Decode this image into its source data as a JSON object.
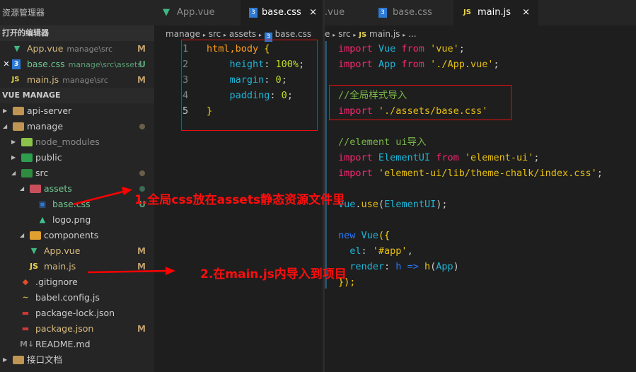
{
  "sidebar": {
    "title": "资源管理器",
    "open_editors_header": "打开的编辑器",
    "open_editors": [
      {
        "name": "App.vue",
        "path": "manage\\src",
        "status": "M",
        "icon": "vue-icon"
      },
      {
        "name": "base.css",
        "path": "manage\\src\\assets",
        "status": "U",
        "icon": "css-icon"
      },
      {
        "name": "main.js",
        "path": "manage\\src",
        "status": "M",
        "icon": "js-icon"
      }
    ],
    "project_header": "VUE MANAGE",
    "tree": [
      {
        "name": "api-server",
        "status": ""
      },
      {
        "name": "manage",
        "status": ""
      },
      {
        "name": "node_modules",
        "status": ""
      },
      {
        "name": "public",
        "status": ""
      },
      {
        "name": "src",
        "status": ""
      },
      {
        "name": "assets",
        "status": ""
      },
      {
        "name": "base.css",
        "status": "U"
      },
      {
        "name": "logo.png",
        "status": ""
      },
      {
        "name": "components",
        "status": ""
      },
      {
        "name": "App.vue",
        "status": "M"
      },
      {
        "name": "main.js",
        "status": "M"
      },
      {
        "name": ".gitignore",
        "status": ""
      },
      {
        "name": "babel.config.js",
        "status": ""
      },
      {
        "name": "package-lock.json",
        "status": ""
      },
      {
        "name": "package.json",
        "status": "M"
      },
      {
        "name": "README.md",
        "status": ""
      },
      {
        "name": "接口文档",
        "status": ""
      }
    ]
  },
  "left_editor": {
    "tabs": [
      {
        "label": "App.vue"
      },
      {
        "label": "base.css",
        "close": "×"
      }
    ],
    "breadcrumb": [
      "manage",
      "src",
      "assets",
      "base.css"
    ],
    "line_numbers": [
      "1",
      "2",
      "3",
      "4",
      "5"
    ]
  },
  "right_editor": {
    "tabs": [
      {
        "label": ".vue"
      },
      {
        "label": "base.css"
      },
      {
        "label": "main.js",
        "close": "×"
      }
    ],
    "breadcrumb": [
      "e",
      "src",
      "main.js",
      "..."
    ]
  },
  "annotations": {
    "note1": "1.全局css放在assets静态资源文件里",
    "note2": "2.在main.js内导入到项目",
    "color": "#ff0d0d"
  },
  "css_code": [
    [
      [
        "html,body ",
        "sel"
      ],
      [
        "{",
        "br"
      ]
    ],
    [
      [
        "    height",
        "pr"
      ],
      [
        ": ",
        "pun"
      ],
      [
        "100%",
        "num2"
      ],
      [
        ";",
        "pun"
      ]
    ],
    [
      [
        "    margin",
        "pr"
      ],
      [
        ": ",
        "pun"
      ],
      [
        "0",
        "num2"
      ],
      [
        ";",
        "pun"
      ]
    ],
    [
      [
        "    padding",
        "pr"
      ],
      [
        ": ",
        "pun"
      ],
      [
        "0",
        "num2"
      ],
      [
        ";",
        "pun"
      ]
    ],
    [
      [
        "}",
        "br"
      ]
    ]
  ],
  "js_code": [
    [
      [
        "import ",
        "kw"
      ],
      [
        "Vue ",
        "cls"
      ],
      [
        "from ",
        "kw"
      ],
      [
        "'vue'",
        "str"
      ],
      [
        ";",
        "pun"
      ]
    ],
    [
      [
        "import ",
        "kw"
      ],
      [
        "App ",
        "cls"
      ],
      [
        "from ",
        "kw"
      ],
      [
        "'./App.vue'",
        "str"
      ],
      [
        ";",
        "pun"
      ]
    ],
    [],
    [
      [
        "//全局样式导入",
        "cm"
      ]
    ],
    [
      [
        "import ",
        "kw"
      ],
      [
        "'./assets/base.css'",
        "str"
      ]
    ],
    [],
    [
      [
        "//element ui导入",
        "cm"
      ]
    ],
    [
      [
        "import ",
        "kw"
      ],
      [
        "ElementUI ",
        "cls"
      ],
      [
        "from ",
        "kw"
      ],
      [
        "'element-ui'",
        "str"
      ],
      [
        ";",
        "pun"
      ]
    ],
    [
      [
        "import ",
        "kw"
      ],
      [
        "'element-ui/lib/theme-chalk/index.css'",
        "str"
      ],
      [
        ";",
        "pun"
      ]
    ],
    [],
    [
      [
        "Vue",
        "cls"
      ],
      [
        ".",
        "pun"
      ],
      [
        "use",
        "str"
      ],
      [
        "(",
        "pun"
      ],
      [
        "ElementUI",
        "cls"
      ],
      [
        ");",
        "pun"
      ]
    ],
    [],
    [
      [
        "new ",
        "nw"
      ],
      [
        "Vue",
        "cls"
      ],
      [
        "({",
        "br"
      ]
    ],
    [
      [
        "  el",
        "pr"
      ],
      [
        ": ",
        "pun"
      ],
      [
        "'#app'",
        "str"
      ],
      [
        ",",
        "pun"
      ]
    ],
    [
      [
        "  render",
        "pr"
      ],
      [
        ": ",
        "pun"
      ],
      [
        "h ",
        "nw"
      ],
      [
        "=> ",
        "nw"
      ],
      [
        "h",
        "str"
      ],
      [
        "(",
        "pun"
      ],
      [
        "App",
        "cls"
      ],
      [
        ")",
        "pun"
      ]
    ],
    [
      [
        "});",
        "br"
      ]
    ]
  ]
}
